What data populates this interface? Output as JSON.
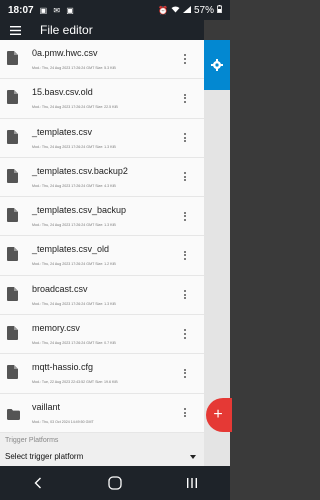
{
  "status": {
    "time": "18:07",
    "battery": "57%"
  },
  "app_bar": {
    "title": "File editor"
  },
  "files": [
    {
      "name": "0a.pmw.hwc.csv",
      "meta": "Mod.: Thu, 24 Aug 2023 17:26:24 GMT  Size: 5.3 KiB",
      "type": "file"
    },
    {
      "name": "15.basv.csv.old",
      "meta": "Mod.: Thu, 24 Aug 2023 17:26:24 GMT  Size: 22.5 KiB",
      "type": "file"
    },
    {
      "name": "_templates.csv",
      "meta": "Mod.: Thu, 24 Aug 2023 17:26:24 GMT  Size: 1.3 KiB",
      "type": "file"
    },
    {
      "name": "_templates.csv.backup2",
      "meta": "Mod.: Thu, 24 Aug 2023 17:26:24 GMT  Size: 4.3 KiB",
      "type": "file"
    },
    {
      "name": "_templates.csv_backup",
      "meta": "Mod.: Thu, 24 Aug 2023 17:26:24 GMT  Size: 1.3 KiB",
      "type": "file"
    },
    {
      "name": "_templates.csv_old",
      "meta": "Mod.: Thu, 24 Aug 2023 17:26:24 GMT  Size: 1.2 KiB",
      "type": "file"
    },
    {
      "name": "broadcast.csv",
      "meta": "Mod.: Thu, 24 Aug 2023 17:26:24 GMT  Size: 1.3 KiB",
      "type": "file"
    },
    {
      "name": "memory.csv",
      "meta": "Mod.: Thu, 24 Aug 2023 17:26:24 GMT  Size: 0.7 KiB",
      "type": "file"
    },
    {
      "name": "mqtt-hassio.cfg",
      "meta": "Mod.: Tue, 22 Aug 2023 22:43:52 GMT  Size: 19.6 KiB",
      "type": "file"
    },
    {
      "name": "vaillant",
      "meta": "Mod.: Thu, 03 Oct 2024 14:49:50 GMT",
      "type": "folder"
    }
  ],
  "form": {
    "label": "Trigger Platforms",
    "select_value": "Select trigger platform"
  },
  "colors": {
    "appbar": "#1e2329",
    "accent": "#0388d1",
    "fab": "#e53935"
  }
}
